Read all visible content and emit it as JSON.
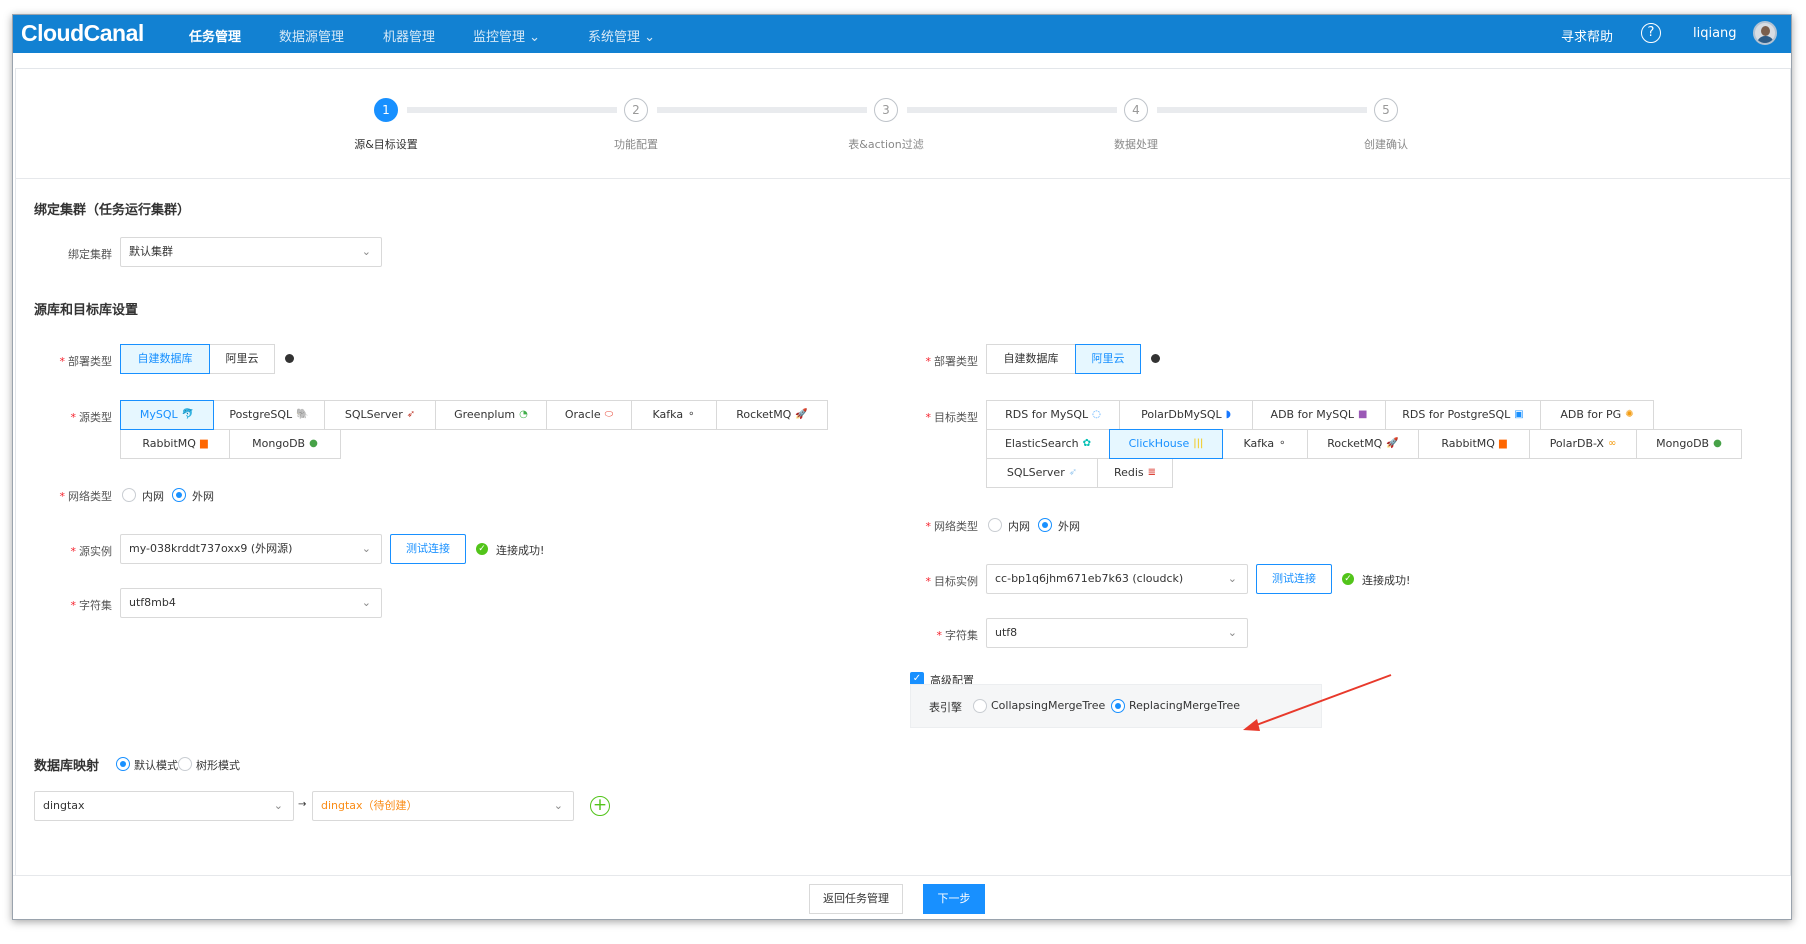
{
  "nav": {
    "logo": "CloudCanal",
    "items": [
      "任务管理",
      "数据源管理",
      "机器管理",
      "监控管理 ⌄",
      "系统管理 ⌄"
    ],
    "help": "寻求帮助",
    "help_icon": "?",
    "user": "liqiang"
  },
  "steps": [
    {
      "num": "1",
      "label": "源&目标设置"
    },
    {
      "num": "2",
      "label": "功能配置"
    },
    {
      "num": "3",
      "label": "表&action过滤"
    },
    {
      "num": "4",
      "label": "数据处理"
    },
    {
      "num": "5",
      "label": "创建确认"
    }
  ],
  "cluster": {
    "section_title": "绑定集群（任务运行集群）",
    "label": "绑定集群",
    "value": "默认集群"
  },
  "db_section_title": "源库和目标库设置",
  "chevron": "⌄",
  "required_mark": "*",
  "check_mark": "✓",
  "source": {
    "deploy_label": "部署类型",
    "deploy_options": [
      "自建数据库",
      "阿里云"
    ],
    "type_label": "源类型",
    "types_row1": [
      "MySQL",
      "PostgreSQL",
      "SQLServer",
      "Greenplum",
      "Oracle",
      "Kafka",
      "RocketMQ"
    ],
    "types_row2": [
      "RabbitMQ",
      "MongoDB"
    ],
    "network_label": "网络类型",
    "network_options": [
      "内网",
      "外网"
    ],
    "instance_label": "源实例",
    "instance_value": "my-038krddt737oxx9 (外网源)",
    "test_button": "测试连接",
    "status": "连接成功!",
    "charset_label": "字符集",
    "charset_value": "utf8mb4"
  },
  "target": {
    "deploy_label": "部署类型",
    "deploy_options": [
      "自建数据库",
      "阿里云"
    ],
    "type_label": "目标类型",
    "types_row1": [
      "RDS for MySQL",
      "PolarDbMySQL",
      "ADB for MySQL",
      "RDS for PostgreSQL",
      "ADB for PG"
    ],
    "types_row2": [
      "ElasticSearch",
      "ClickHouse",
      "Kafka",
      "RocketMQ",
      "RabbitMQ",
      "PolarDB-X",
      "MongoDB"
    ],
    "types_row3": [
      "SQLServer",
      "Redis"
    ],
    "network_label": "网络类型",
    "network_options": [
      "内网",
      "外网"
    ],
    "instance_label": "目标实例",
    "instance_value": "cc-bp1q6jhm671eb7k63 (cloudck)",
    "test_button": "测试连接",
    "status": "连接成功!",
    "charset_label": "字符集",
    "charset_value": "utf8",
    "advanced_label": "高级配置",
    "engine_label": "表引擎",
    "engine_options": [
      "CollapsingMergeTree",
      "ReplacingMergeTree"
    ]
  },
  "mapping": {
    "label": "数据库映射",
    "modes": [
      "默认模式",
      "树形模式"
    ],
    "source_db": "dingtax",
    "target_db": "dingtax（待创建）",
    "arrow": "→",
    "plus": "+"
  },
  "footer": {
    "back_button": "返回任务管理",
    "next_button": "下一步"
  },
  "colors": {
    "nav_bg": "#1281d2",
    "primary": "#1890ff",
    "success": "#52c41a",
    "required": "#f5222d",
    "pending_db": "#fa8c16",
    "annotation_arrow": "#e8392b"
  }
}
